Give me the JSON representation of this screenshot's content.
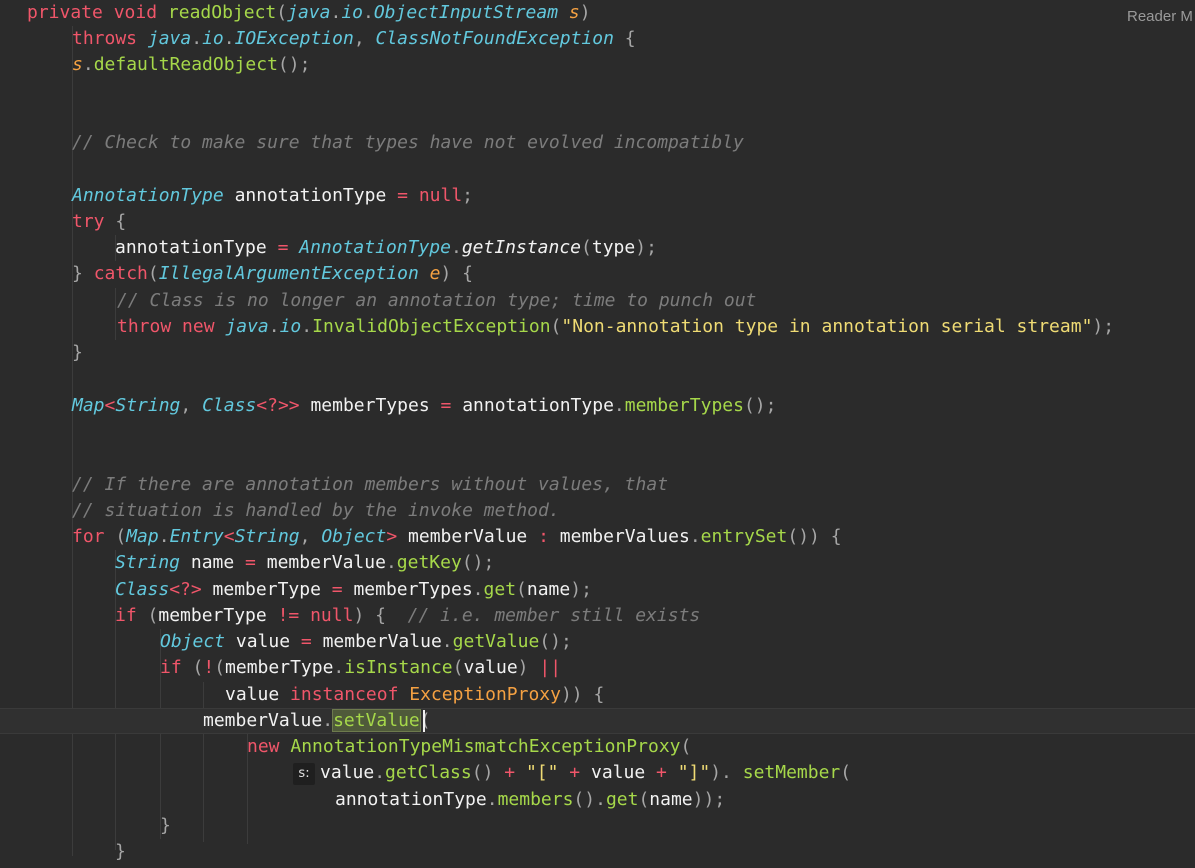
{
  "reader_mode_label": "Reader M",
  "param_hint_label": "s:",
  "lines": [
    [
      [
        "kw",
        "private "
      ],
      [
        "kw",
        "void "
      ],
      [
        "fn",
        "readObject"
      ],
      [
        "pu",
        "("
      ],
      [
        "ty",
        "java"
      ],
      [
        "pu",
        "."
      ],
      [
        "ty",
        "io"
      ],
      [
        "pu",
        "."
      ],
      [
        "ty",
        "ObjectInputStream "
      ],
      [
        "pa",
        "s"
      ],
      [
        "pu",
        ")"
      ]
    ],
    [
      [
        "kw",
        "throws "
      ],
      [
        "ty",
        "java"
      ],
      [
        "pu",
        "."
      ],
      [
        "ty",
        "io"
      ],
      [
        "pu",
        "."
      ],
      [
        "ty",
        "IOException"
      ],
      [
        "pu",
        ", "
      ],
      [
        "ty",
        "ClassNotFoundException "
      ],
      [
        "pu",
        "{"
      ]
    ],
    [
      [
        "pa",
        "s"
      ],
      [
        "pu",
        "."
      ],
      [
        "fn",
        "defaultReadObject"
      ],
      [
        "pu",
        "();"
      ]
    ],
    [],
    [],
    [
      [
        "cm",
        "// Check to make sure that types have not evolved incompatibly"
      ]
    ],
    [],
    [
      [
        "ty",
        "AnnotationType "
      ],
      [
        "id",
        "annotationType "
      ],
      [
        "op",
        "= "
      ],
      [
        "kw",
        "null"
      ],
      [
        "pu",
        ";"
      ]
    ],
    [
      [
        "kw",
        "try "
      ],
      [
        "pu",
        "{"
      ]
    ],
    [
      [
        "id",
        "annotationType "
      ],
      [
        "op",
        "= "
      ],
      [
        "ty",
        "AnnotationType"
      ],
      [
        "pu",
        "."
      ],
      [
        "fi",
        "getInstance"
      ],
      [
        "pu",
        "("
      ],
      [
        "id",
        "type"
      ],
      [
        "pu",
        ");"
      ]
    ],
    [
      [
        "pu",
        "} "
      ],
      [
        "kw",
        "catch"
      ],
      [
        "pu",
        "("
      ],
      [
        "ty",
        "IllegalArgumentException "
      ],
      [
        "pa",
        "e"
      ],
      [
        "pu",
        ") {"
      ]
    ],
    [
      [
        "cm",
        "// Class is no longer an annotation type; time to punch out"
      ]
    ],
    [
      [
        "kw",
        "throw "
      ],
      [
        "kw",
        "new "
      ],
      [
        "ty",
        "java"
      ],
      [
        "pu",
        "."
      ],
      [
        "ty",
        "io"
      ],
      [
        "pu",
        "."
      ],
      [
        "fn",
        "InvalidObjectException"
      ],
      [
        "pu",
        "("
      ],
      [
        "st",
        "\"Non-annotation type in annotation serial stream\""
      ],
      [
        "pu",
        ");"
      ]
    ],
    [
      [
        "pu",
        "}"
      ]
    ],
    [],
    [
      [
        "ty",
        "Map"
      ],
      [
        "op",
        "<"
      ],
      [
        "ty",
        "String"
      ],
      [
        "pu",
        ", "
      ],
      [
        "ty",
        "Class"
      ],
      [
        "op",
        "<?>> "
      ],
      [
        "id",
        "memberTypes "
      ],
      [
        "op",
        "= "
      ],
      [
        "id",
        "annotationType"
      ],
      [
        "pu",
        "."
      ],
      [
        "fn",
        "memberTypes"
      ],
      [
        "pu",
        "();"
      ]
    ],
    [],
    [],
    [
      [
        "cm",
        "// If there are annotation members without values, that"
      ]
    ],
    [
      [
        "cm",
        "// situation is handled by the invoke method."
      ]
    ],
    [
      [
        "kw",
        "for "
      ],
      [
        "pu",
        "("
      ],
      [
        "ty",
        "Map"
      ],
      [
        "pu",
        "."
      ],
      [
        "ty",
        "Entry"
      ],
      [
        "op",
        "<"
      ],
      [
        "ty",
        "String"
      ],
      [
        "pu",
        ", "
      ],
      [
        "ty",
        "Object"
      ],
      [
        "op",
        "> "
      ],
      [
        "id",
        "memberValue "
      ],
      [
        "op",
        ": "
      ],
      [
        "id",
        "memberValues"
      ],
      [
        "pu",
        "."
      ],
      [
        "fn",
        "entrySet"
      ],
      [
        "pu",
        "()) {"
      ]
    ],
    [
      [
        "ty",
        "String "
      ],
      [
        "id",
        "name "
      ],
      [
        "op",
        "= "
      ],
      [
        "id",
        "memberValue"
      ],
      [
        "pu",
        "."
      ],
      [
        "fn",
        "getKey"
      ],
      [
        "pu",
        "();"
      ]
    ],
    [
      [
        "ty",
        "Class"
      ],
      [
        "op",
        "<?> "
      ],
      [
        "id",
        "memberType "
      ],
      [
        "op",
        "= "
      ],
      [
        "id",
        "memberTypes"
      ],
      [
        "pu",
        "."
      ],
      [
        "fn",
        "get"
      ],
      [
        "pu",
        "("
      ],
      [
        "id",
        "name"
      ],
      [
        "pu",
        ");"
      ]
    ],
    [
      [
        "kw",
        "if "
      ],
      [
        "pu",
        "("
      ],
      [
        "id",
        "memberType "
      ],
      [
        "op",
        "!= "
      ],
      [
        "kw",
        "null"
      ],
      [
        "pu",
        ") {  "
      ],
      [
        "cm",
        "// i.e. member still exists"
      ]
    ],
    [
      [
        "ty",
        "Object "
      ],
      [
        "id",
        "value "
      ],
      [
        "op",
        "= "
      ],
      [
        "id",
        "memberValue"
      ],
      [
        "pu",
        "."
      ],
      [
        "fn",
        "getValue"
      ],
      [
        "pu",
        "();"
      ]
    ],
    [
      [
        "kw",
        "if "
      ],
      [
        "pu",
        "("
      ],
      [
        "op",
        "!"
      ],
      [
        "pu",
        "("
      ],
      [
        "id",
        "memberType"
      ],
      [
        "pu",
        "."
      ],
      [
        "fn",
        "isInstance"
      ],
      [
        "pu",
        "("
      ],
      [
        "id",
        "value"
      ],
      [
        "pu",
        ") "
      ],
      [
        "op",
        "||"
      ]
    ],
    [
      [
        "id",
        "value "
      ],
      [
        "kw",
        "instanceof "
      ],
      [
        "cl",
        "ExceptionProxy"
      ],
      [
        "pu",
        ")) {"
      ]
    ],
    [
      [
        "id",
        "memberValue"
      ],
      [
        "pu",
        "."
      ],
      [
        "fn hl",
        "setValue"
      ],
      [
        "pu",
        "("
      ]
    ],
    [
      [
        "kw",
        "new "
      ],
      [
        "fn",
        "AnnotationTypeMismatchExceptionProxy"
      ],
      [
        "pu",
        "("
      ]
    ],
    [
      [
        "id",
        "value"
      ],
      [
        "pu",
        "."
      ],
      [
        "fn",
        "getClass"
      ],
      [
        "pu",
        "() "
      ],
      [
        "op",
        "+ "
      ],
      [
        "st",
        "\"[\" "
      ],
      [
        "op",
        "+ "
      ],
      [
        "id",
        "value "
      ],
      [
        "op",
        "+ "
      ],
      [
        "st",
        "\"]\""
      ],
      [
        "pu",
        "). "
      ],
      [
        "fn",
        "setMember"
      ],
      [
        "pu",
        "("
      ]
    ],
    [
      [
        "id",
        "annotationType"
      ],
      [
        "pu",
        "."
      ],
      [
        "fn",
        "members"
      ],
      [
        "pu",
        "()."
      ],
      [
        "fn",
        "get"
      ],
      [
        "pu",
        "("
      ],
      [
        "id",
        "name"
      ],
      [
        "pu",
        "));"
      ]
    ],
    [
      [
        "pu",
        "}"
      ]
    ],
    [
      [
        "pu",
        "}"
      ]
    ]
  ]
}
